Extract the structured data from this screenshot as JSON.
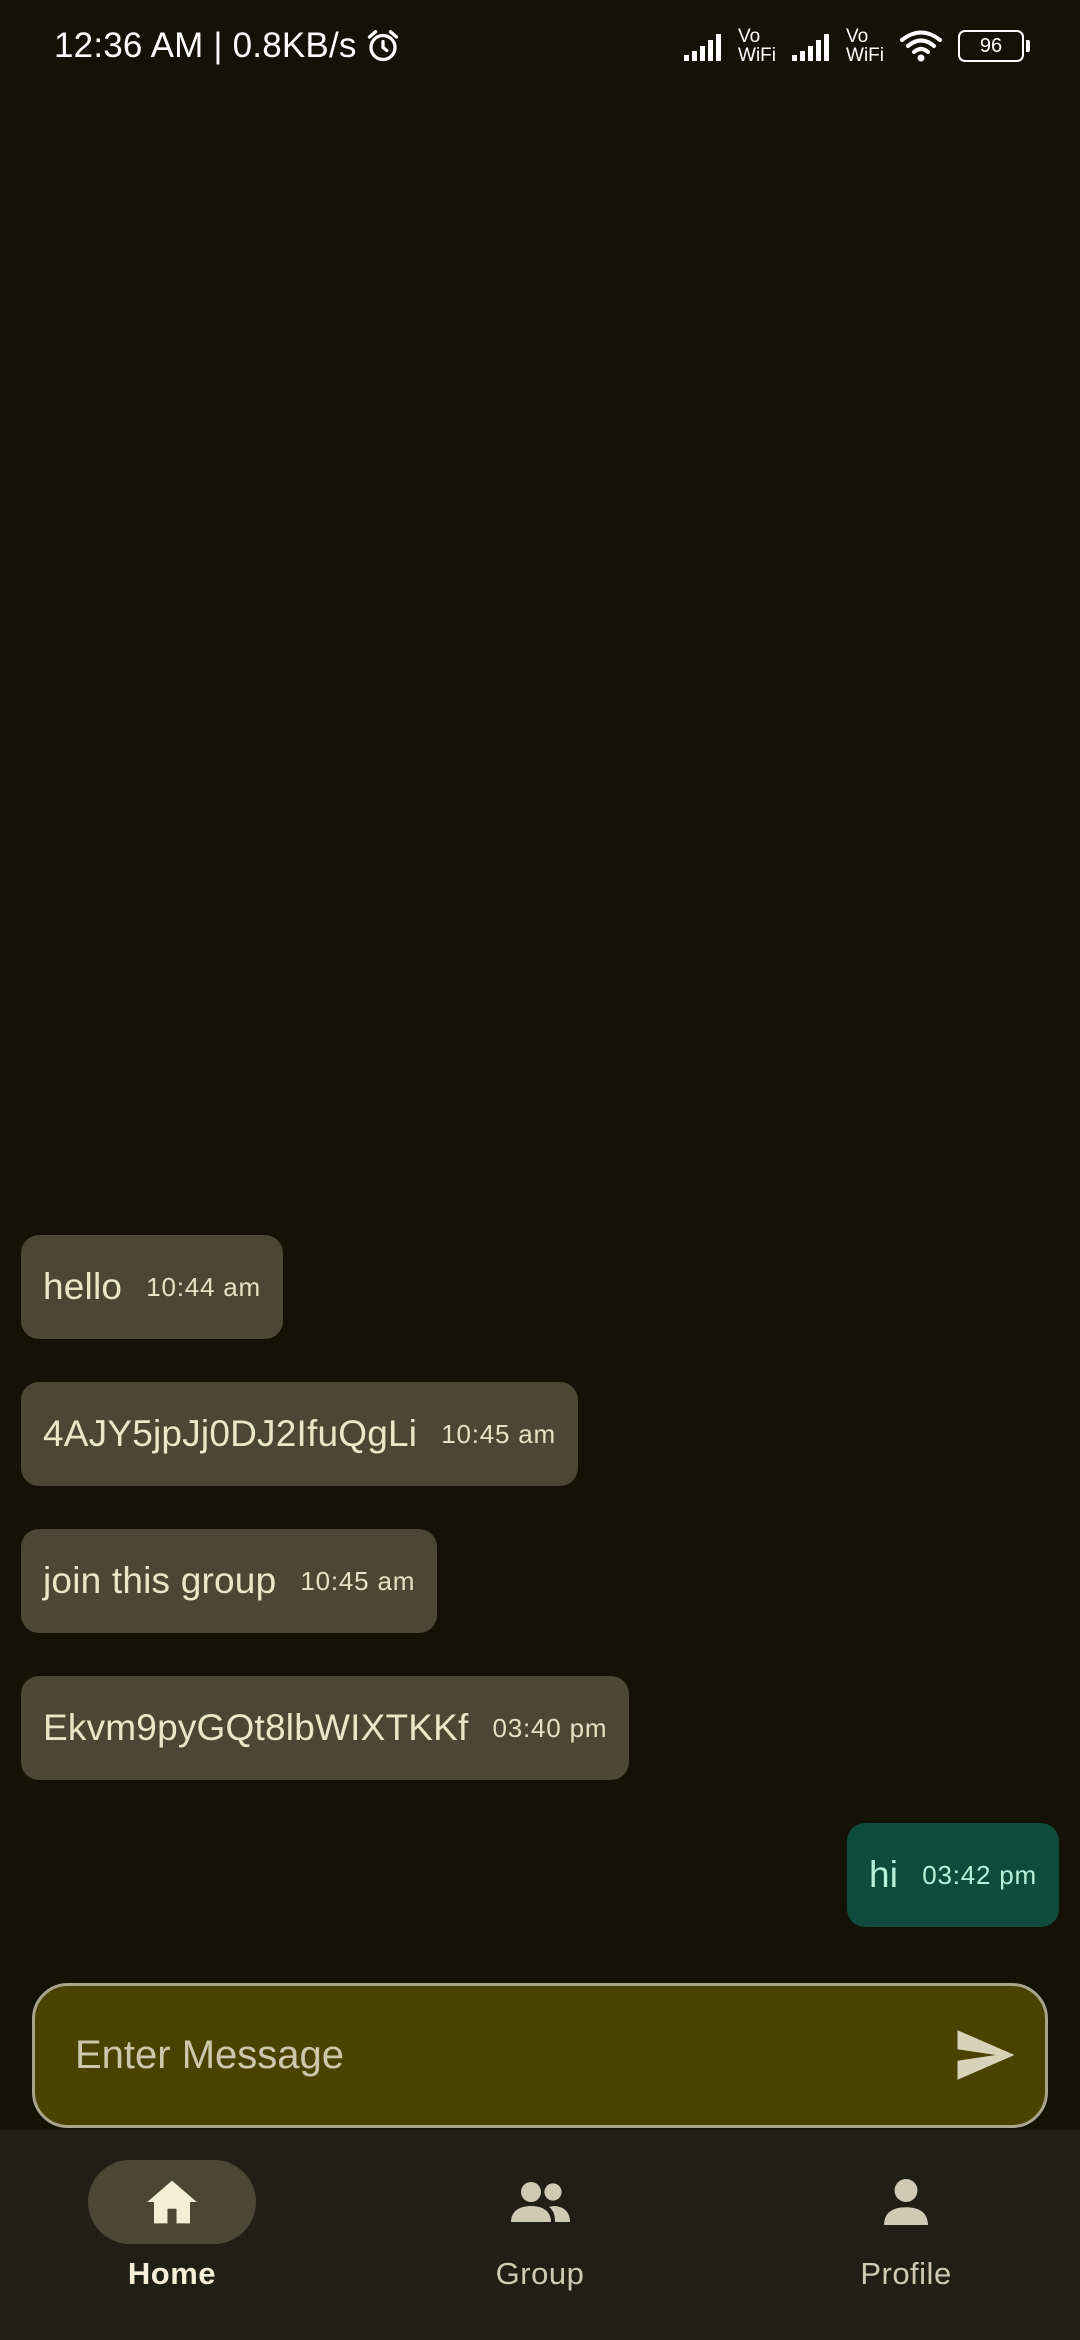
{
  "status_bar": {
    "time_speed": "12:36 AM | 0.8KB/s",
    "vowifi_1_top": "Vo",
    "vowifi_1_bottom": "WiFi",
    "vowifi_2_top": "Vo",
    "vowifi_2_bottom": "WiFi",
    "battery": "96"
  },
  "messages": [
    {
      "text": "hello",
      "time": "10:44 am",
      "direction": "in"
    },
    {
      "text": "4AJY5jpJj0DJ2IfuQgLi",
      "time": "10:45 am",
      "direction": "in"
    },
    {
      "text": "join this group",
      "time": "10:45 am",
      "direction": "in"
    },
    {
      "text": "Ekvm9pyGQt8lbWIXTKKf",
      "time": "03:40 pm",
      "direction": "in"
    },
    {
      "text": "hi",
      "time": "03:42 pm",
      "direction": "out"
    }
  ],
  "composer": {
    "placeholder": "Enter Message",
    "value": ""
  },
  "nav": {
    "items": [
      {
        "label": "Home",
        "icon": "home-icon",
        "active": true
      },
      {
        "label": "Group",
        "icon": "group-icon",
        "active": false
      },
      {
        "label": "Profile",
        "icon": "person-icon",
        "active": false
      }
    ]
  },
  "colors": {
    "background": "#141206",
    "incoming_bubble": "#4a4834",
    "outgoing_bubble": "#0e4b3a",
    "composer_fill": "#4a4300",
    "nav_background": "#201f16"
  }
}
